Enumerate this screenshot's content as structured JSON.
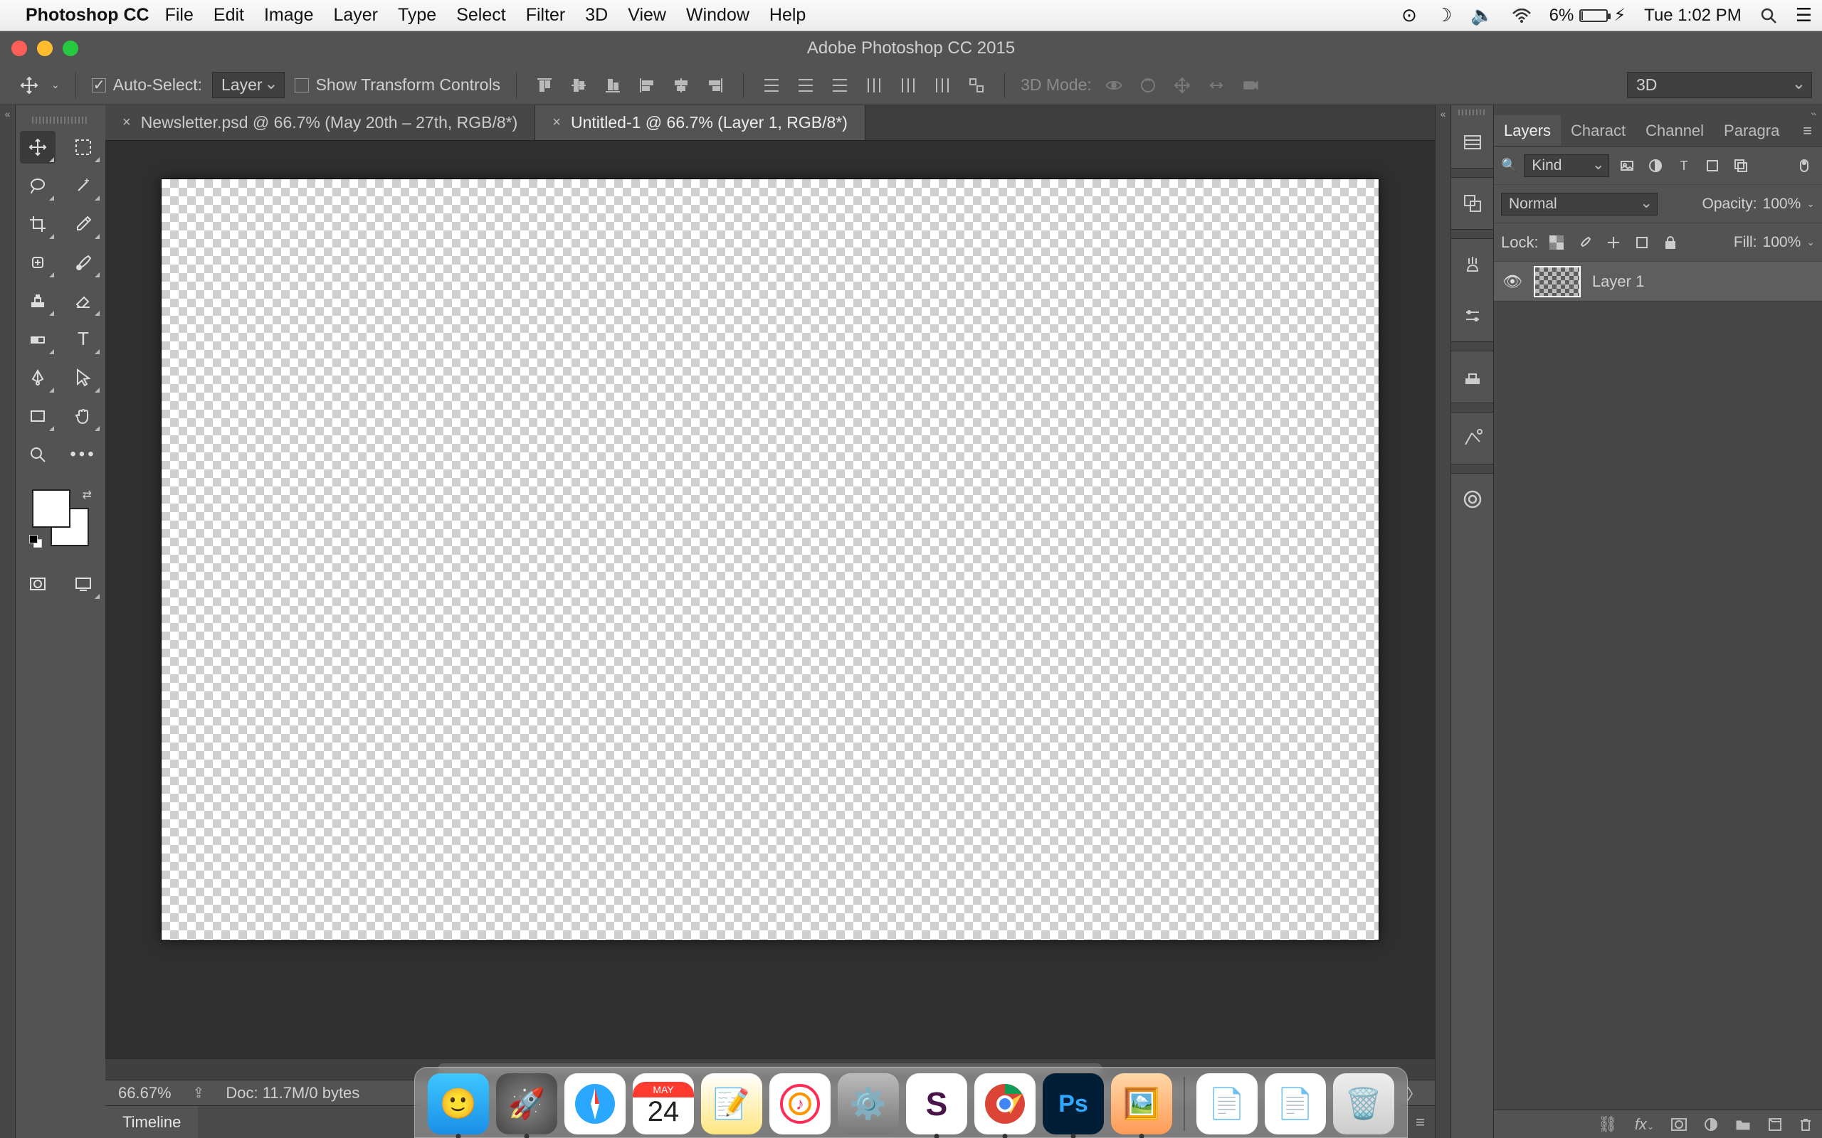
{
  "menubar": {
    "app_name": "Photoshop CC",
    "items": [
      "File",
      "Edit",
      "Image",
      "Layer",
      "Type",
      "Select",
      "Filter",
      "3D",
      "View",
      "Window",
      "Help"
    ],
    "battery_pct": "6%",
    "clock": "Tue 1:02 PM"
  },
  "window": {
    "title": "Adobe Photoshop CC 2015"
  },
  "options": {
    "auto_select_label": "Auto-Select:",
    "auto_select_target": "Layer",
    "show_transform_label": "Show Transform Controls",
    "mode3d_label": "3D Mode:",
    "dropdown_3d": "3D"
  },
  "doc_tabs": [
    {
      "label": "Newsletter.psd @ 66.7% (May 20th – 27th, RGB/8*)",
      "active": false
    },
    {
      "label": "Untitled-1 @ 66.7% (Layer 1, RGB/8*)",
      "active": true
    }
  ],
  "status": {
    "zoom": "66.67%",
    "doc_info": "Doc: 11.7M/0 bytes"
  },
  "timeline": {
    "label": "Timeline"
  },
  "layers_panel": {
    "tabs": [
      "Layers",
      "Charact",
      "Channel",
      "Paragra"
    ],
    "filter_label": "Kind",
    "blend_mode": "Normal",
    "opacity_label": "Opacity:",
    "opacity_value": "100%",
    "lock_label": "Lock:",
    "fill_label": "Fill:",
    "fill_value": "100%",
    "layers": [
      {
        "name": "Layer 1"
      }
    ]
  },
  "dock": {
    "apps": [
      "Finder",
      "Launchpad",
      "Safari",
      "Calendar",
      "Notes",
      "iTunes",
      "System Preferences",
      "Slack",
      "Chrome",
      "Photoshop",
      "Photos"
    ],
    "calendar_month": "MAY",
    "calendar_day": "24"
  }
}
